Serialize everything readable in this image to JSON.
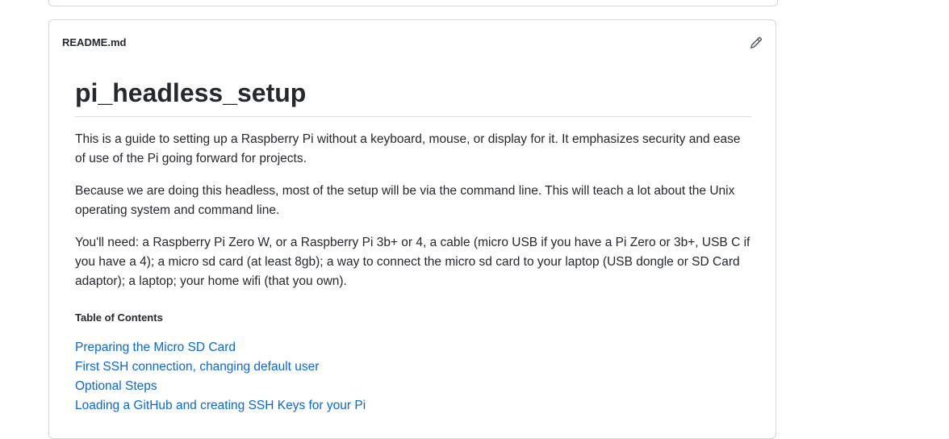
{
  "readme": {
    "filename": "README.md",
    "edit_icon": "pencil-icon"
  },
  "content": {
    "title": "pi_headless_setup",
    "paragraphs": [
      "This is a guide to setting up a Raspberry Pi without a keyboard, mouse, or display for it. It emphasizes security and ease of use of the Pi going forward for projects.",
      "Because we are doing this headless, most of the setup will be via the command line. This will teach a lot about the Unix operating system and command line.",
      "You'll need: a Raspberry Pi Zero W, or a Raspberry Pi 3b+ or 4, a cable (micro USB if you have a Pi Zero or 3b+, USB C if you have a 4); a micro sd card (at least 8gb); a way to connect the micro sd card to your laptop (USB dongle or SD Card adaptor); a laptop; your home wifi (that you own)."
    ],
    "toc_title": "Table of Contents",
    "toc_links": [
      "Preparing the Micro SD Card",
      "First SSH connection, changing default user",
      "Optional Steps",
      "Loading a GitHub and creating SSH Keys for your Pi"
    ]
  },
  "colors": {
    "link": "#0969da",
    "border": "#d0d7de",
    "text": "#24292f"
  }
}
